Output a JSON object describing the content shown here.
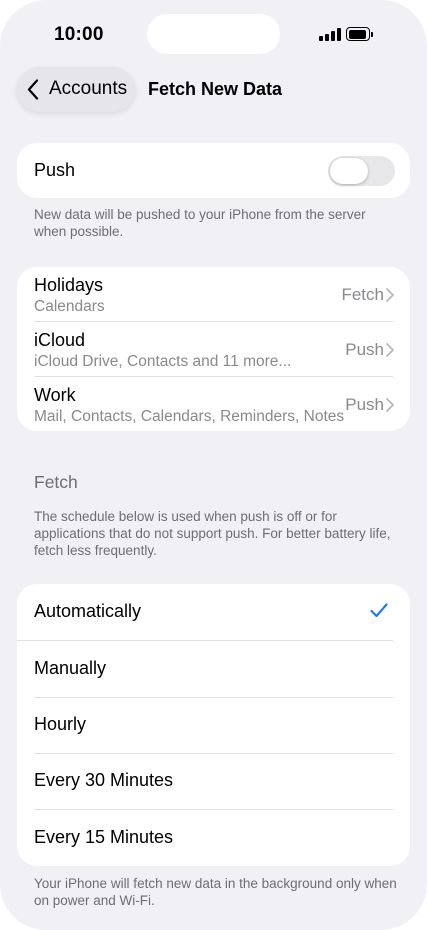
{
  "status_bar": {
    "time": "10:00"
  },
  "nav": {
    "back_label": "Accounts",
    "title": "Fetch New Data"
  },
  "push": {
    "label": "Push",
    "enabled": false,
    "footnote": "New data will be pushed to your iPhone from the server when possible."
  },
  "accounts": [
    {
      "title": "Holidays",
      "subtitle": "Calendars",
      "value": "Fetch"
    },
    {
      "title": "iCloud",
      "subtitle": "iCloud Drive, Contacts and 11 more...",
      "value": "Push"
    },
    {
      "title": "Work",
      "subtitle": "Mail, Contacts, Calendars, Reminders, Notes",
      "value": "Push"
    }
  ],
  "fetch": {
    "header": "Fetch",
    "description": "The schedule below is used when push is off or for applications that do not support push. For better battery life, fetch less frequently.",
    "options": [
      {
        "label": "Automatically",
        "selected": true
      },
      {
        "label": "Manually",
        "selected": false
      },
      {
        "label": "Hourly",
        "selected": false
      },
      {
        "label": "Every 30 Minutes",
        "selected": false
      },
      {
        "label": "Every 15 Minutes",
        "selected": false
      }
    ],
    "footnote": "Your iPhone will fetch new data in the background only when on power and Wi-Fi."
  },
  "colors": {
    "accent": "#1a7cf2",
    "background": "#f1f0f5",
    "secondary_text": "#6d6d72"
  }
}
